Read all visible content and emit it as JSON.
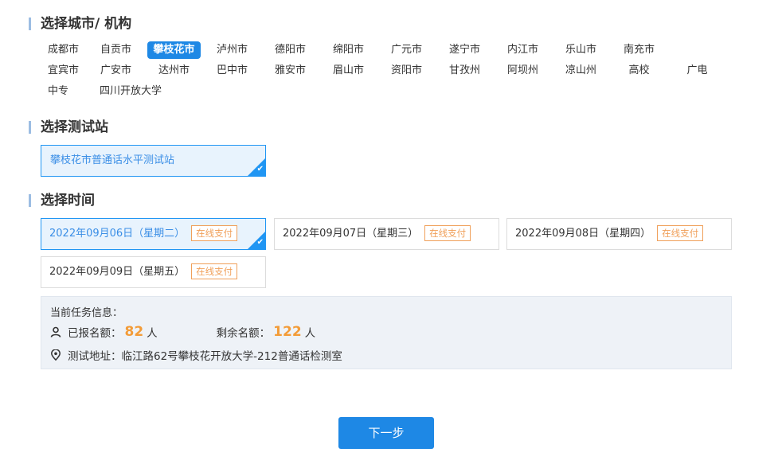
{
  "sections": {
    "city_title": "选择城市/ 机构",
    "station_title": "选择测试站",
    "time_title": "选择时间"
  },
  "cities": {
    "row1": [
      "成都市",
      "自贡市",
      "攀枝花市",
      "泸州市",
      "德阳市",
      "绵阳市",
      "广元市",
      "遂宁市",
      "内江市",
      "乐山市",
      "南充市"
    ],
    "row2": [
      "宜宾市",
      "广安市",
      "达州市",
      "巴中市",
      "雅安市",
      "眉山市",
      "资阳市",
      "甘孜州",
      "阿坝州",
      "凉山州",
      "高校",
      "广电"
    ],
    "row3": [
      "中专",
      "四川开放大学"
    ],
    "selected": "攀枝花市"
  },
  "station": {
    "name": "攀枝花市普通话水平测试站",
    "selected": true
  },
  "dates": [
    {
      "date": "2022年09月06日（星期二）",
      "tag": "在线支付",
      "selected": true
    },
    {
      "date": "2022年09月07日（星期三）",
      "tag": "在线支付",
      "selected": false
    },
    {
      "date": "2022年09月08日（星期四）",
      "tag": "在线支付",
      "selected": false
    },
    {
      "date": "2022年09月09日（星期五）",
      "tag": "在线支付",
      "selected": false
    }
  ],
  "info": {
    "title": "当前任务信息：",
    "registered_label": "已报名额：",
    "registered_count": "82",
    "registered_unit": "人",
    "remaining_label": "剩余名额：",
    "remaining_count": "122",
    "remaining_unit": "人",
    "address_label": "测试地址：",
    "address": "临江路62号攀枝花开放大学-212普通话检测室"
  },
  "next_button": "下一步",
  "colors": {
    "accent": "#1e88e5",
    "tag": "#f0a05a",
    "count": "#f39c38"
  },
  "icons": {
    "registered": "user-icon",
    "address": "location-pin-icon",
    "selected": "check-corner-icon"
  }
}
